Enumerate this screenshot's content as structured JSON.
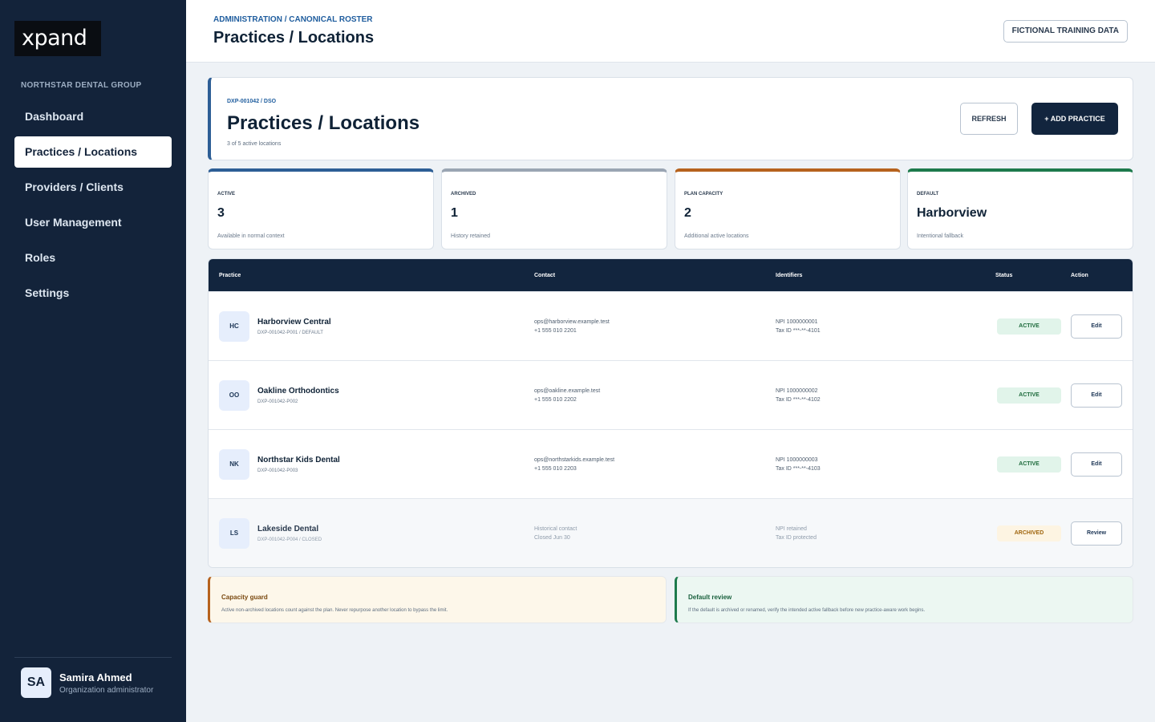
{
  "app": {
    "logo": "xpand"
  },
  "sidebar": {
    "org_name": "NORTHSTAR DENTAL GROUP",
    "items": [
      {
        "label": "Dashboard",
        "active": false
      },
      {
        "label": "Practices / Locations",
        "active": true
      },
      {
        "label": "Providers / Clients",
        "active": false
      },
      {
        "label": "User Management",
        "active": false
      },
      {
        "label": "Roles",
        "active": false
      },
      {
        "label": "Settings",
        "active": false
      }
    ],
    "user": {
      "initials": "SA",
      "name": "Samira Ahmed",
      "role": "Organization administrator"
    }
  },
  "header": {
    "breadcrumb": "ADMINISTRATION / CANONICAL ROSTER",
    "title": "Practices / Locations",
    "badge": "FICTIONAL TRAINING DATA"
  },
  "hero": {
    "code": "DXP-001042 / DSO",
    "title": "Practices / Locations",
    "subtitle": "3 of 5 active locations",
    "refresh_label": "REFRESH",
    "add_label": "+ ADD PRACTICE"
  },
  "stats": [
    {
      "label": "ACTIVE",
      "value": "3",
      "note": "Available in normal context",
      "color": "#2d5e95"
    },
    {
      "label": "ARCHIVED",
      "value": "1",
      "note": "History retained",
      "color": "#9aa5b3"
    },
    {
      "label": "PLAN CAPACITY",
      "value": "2",
      "note": "Additional active locations",
      "color": "#b6621d"
    },
    {
      "label": "DEFAULT",
      "value": "Harborview",
      "note": "Intentional fallback",
      "color": "#1d7a4c"
    }
  ],
  "table": {
    "headers": {
      "practice": "Practice",
      "contact": "Contact",
      "identifiers": "Identifiers",
      "status": "Status",
      "action": "Action"
    },
    "rows": [
      {
        "initials": "HC",
        "name": "Harborview Central",
        "code": "DXP-001042-P001 / DEFAULT",
        "contact1": "ops@harborview.example.test",
        "contact2": "+1 555 010 2201",
        "id1": "NPI 1000000001",
        "id2": "Tax ID ***-**-4101",
        "status": "ACTIVE",
        "action": "Edit"
      },
      {
        "initials": "OO",
        "name": "Oakline Orthodontics",
        "code": "DXP-001042-P002",
        "contact1": "ops@oakline.example.test",
        "contact2": "+1 555 010 2202",
        "id1": "NPI 1000000002",
        "id2": "Tax ID ***-**-4102",
        "status": "ACTIVE",
        "action": "Edit"
      },
      {
        "initials": "NK",
        "name": "Northstar Kids Dental",
        "code": "DXP-001042-P003",
        "contact1": "ops@northstarkids.example.test",
        "contact2": "+1 555 010 2203",
        "id1": "NPI 1000000003",
        "id2": "Tax ID ***-**-4103",
        "status": "ACTIVE",
        "action": "Edit"
      },
      {
        "initials": "LS",
        "name": "Lakeside Dental",
        "code": "DXP-001042-P004 / CLOSED",
        "contact1": "Historical contact",
        "contact2": "Closed Jun 30",
        "id1": "NPI retained",
        "id2": "Tax ID protected",
        "status": "ARCHIVED",
        "action": "Review"
      }
    ]
  },
  "notes": {
    "capacity": {
      "title": "Capacity guard",
      "text": "Active non-archived locations count against the plan. Never repurpose another location to bypass the limit."
    },
    "default": {
      "title": "Default review",
      "text": "If the default is archived or renamed, verify the intended active fallback before new practice-aware work begins."
    }
  }
}
